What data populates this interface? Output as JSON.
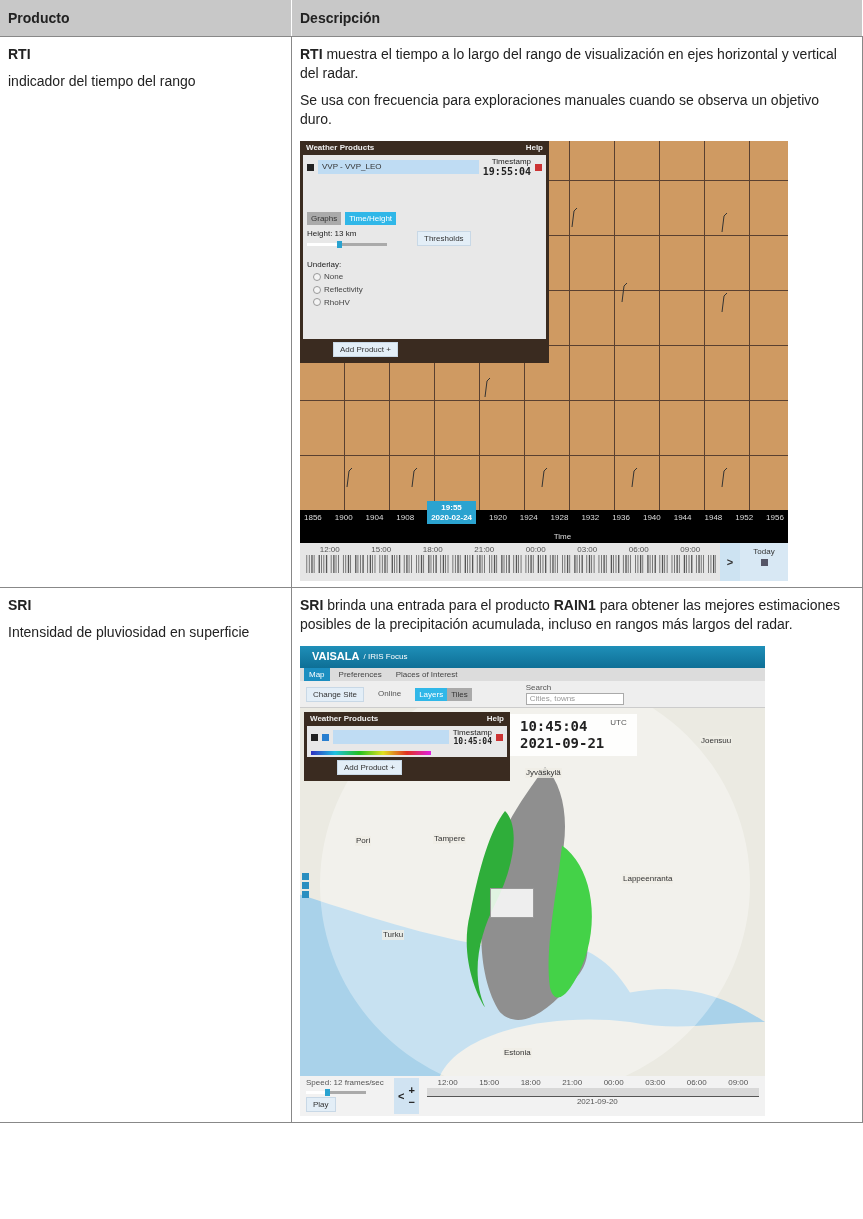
{
  "table": {
    "columns": [
      "Producto",
      "Descripción"
    ],
    "rows": [
      {
        "product": "RTI",
        "product_name": "indicador del tiempo del rango",
        "paragraphs": [
          "**RTI** muestra el tiempo a lo largo del rango de visualización en ejes horizontal y vertical del radar.",
          "Se usa con frecuencia para exploraciones manuales cuando se observa un objetivo duro."
        ],
        "screenshot": {
          "kind": "rti",
          "panel": {
            "title": "Weather Products",
            "help": "Help",
            "product": "VVP - VVP_LEO",
            "timestamp_label": "Timestamp",
            "timestamp": "19:55:04",
            "view_tabs": [
              {
                "label": "Graphs",
                "selected": false
              },
              {
                "label": "Time/Height",
                "selected": true
              }
            ],
            "height_slider": {
              "label": "Height: 13 km",
              "level": 0.4
            },
            "thresholds": "Thresholds",
            "underlay_label": "Underlay:",
            "underlay_options": [
              {
                "label": "None",
                "selected": false
              },
              {
                "label": "Reflectivity",
                "selected": false
              },
              {
                "label": "RhoHV",
                "selected": false
              }
            ],
            "add_product": "Add Product +"
          },
          "axis_ticks": [
            "1856",
            "1900",
            "1904",
            "1908",
            "1920",
            "1924",
            "1928",
            "1932",
            "1936",
            "1940",
            "1944",
            "1948",
            "1952",
            "1956"
          ],
          "cursor_time": "19:55",
          "cursor_date": "2020-02-24",
          "axis_label": "Time",
          "timeline_ticks": [
            "12:00",
            "15:00",
            "18:00",
            "21:00",
            "00:00",
            "03:00",
            "06:00",
            "09:00"
          ],
          "next": ">",
          "today": "Today"
        }
      },
      {
        "product": "SRI",
        "product_name": "Intensidad de pluviosidad en superficie",
        "paragraphs": [
          "**SRI** brinda una entrada para el producto **RAIN1** para obtener las mejores estimaciones posibles de la precipitación acumulada, incluso en rangos más largos del radar."
        ],
        "screenshot": {
          "kind": "map",
          "brand": "VAISALA",
          "app": "/ IRIS Focus",
          "tabs": [
            {
              "label": "Map",
              "selected": true
            },
            {
              "label": "Preferences",
              "selected": false
            },
            {
              "label": "Places of Interest",
              "selected": false
            }
          ],
          "change_site": "Change Site",
          "network_status": "Online",
          "view_modes": [
            {
              "label": "Layers",
              "selected": true
            },
            {
              "label": "Tiles",
              "selected": false
            }
          ],
          "search_label": "Search",
          "search_placeholder": "Cities, towns",
          "panel": {
            "title": "Weather Products",
            "help": "Help",
            "timestamp_label": "Timestamp",
            "timestamp": "10:45:04",
            "add_product": "Add Product +"
          },
          "time": "10:45:04",
          "time_zone": "UTC",
          "date": "2021-09-21",
          "cities": [
            "Joensuu",
            "Jyväskylä",
            "Pori",
            "Tampere",
            "Lappeenranta",
            "Turku",
            "Estonia"
          ],
          "speed": "Speed: 12 frames/sec",
          "speed_slider": {
            "level": 0.35
          },
          "play": "Play",
          "step_back": "<",
          "zoom_in": "+",
          "zoom_out": "−",
          "timeline_ticks": [
            "12:00",
            "15:00",
            "18:00",
            "21:00",
            "00:00",
            "03:00",
            "06:00",
            "09:00"
          ],
          "timeline_date": "2021-09-20"
        }
      }
    ]
  }
}
